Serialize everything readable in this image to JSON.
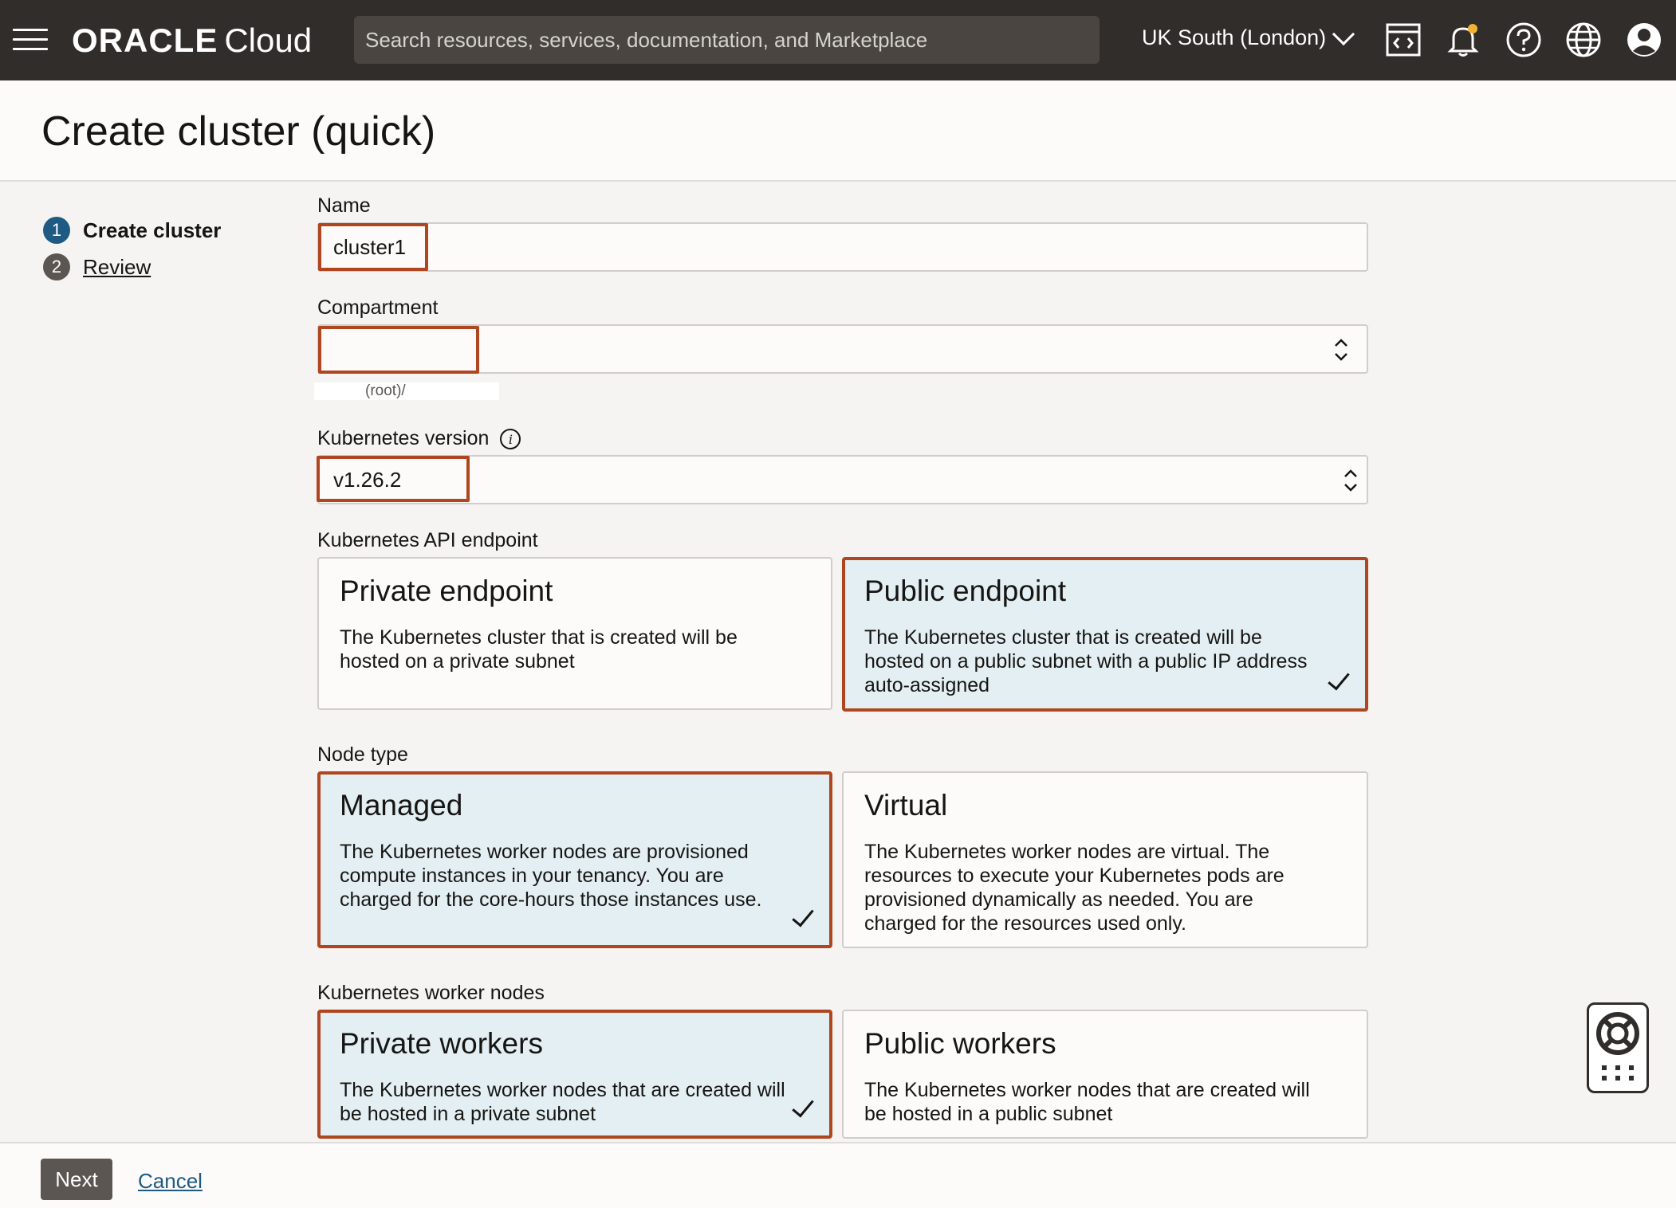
{
  "topbar": {
    "brand": "ORACLE",
    "product": "Cloud",
    "search_placeholder": "Search resources, services, documentation, and Marketplace",
    "region": "UK South (London)"
  },
  "page": {
    "title": "Create cluster (quick)"
  },
  "steps": [
    {
      "number": "1",
      "label": "Create cluster"
    },
    {
      "number": "2",
      "label": "Review"
    }
  ],
  "form": {
    "name": {
      "label": "Name",
      "value": "cluster1"
    },
    "compartment": {
      "label": "Compartment",
      "value": "",
      "helper": "(root)/"
    },
    "k8s_version": {
      "label": "Kubernetes version",
      "value": "v1.26.2"
    },
    "api_endpoint": {
      "label": "Kubernetes API endpoint",
      "options": [
        {
          "title": "Private endpoint",
          "desc": "The Kubernetes cluster that is created will be hosted on a private subnet"
        },
        {
          "title": "Public endpoint",
          "desc": "The Kubernetes cluster that is created will be hosted on a public subnet with a public IP address auto-assigned"
        }
      ]
    },
    "node_type": {
      "label": "Node type",
      "options": [
        {
          "title": "Managed",
          "desc": "The Kubernetes worker nodes are provisioned compute instances in your tenancy. You are charged for the core-hours those instances use."
        },
        {
          "title": "Virtual",
          "desc": "The Kubernetes worker nodes are virtual. The resources to execute your Kubernetes pods are provisioned dynamically as needed. You are charged for the resources used only."
        }
      ]
    },
    "worker_nodes": {
      "label": "Kubernetes worker nodes",
      "options": [
        {
          "title": "Private workers",
          "desc": "The Kubernetes worker nodes that are created will be hosted in a private subnet"
        },
        {
          "title": "Public workers",
          "desc": "The Kubernetes worker nodes that are created will be hosted in a public subnet"
        }
      ]
    }
  },
  "footer": {
    "next": "Next",
    "cancel": "Cancel"
  },
  "colors": {
    "topbar": "#312d2a",
    "accent": "#1e5a82",
    "highlight": "#b0461f",
    "selected_bg": "#e4eff3"
  }
}
